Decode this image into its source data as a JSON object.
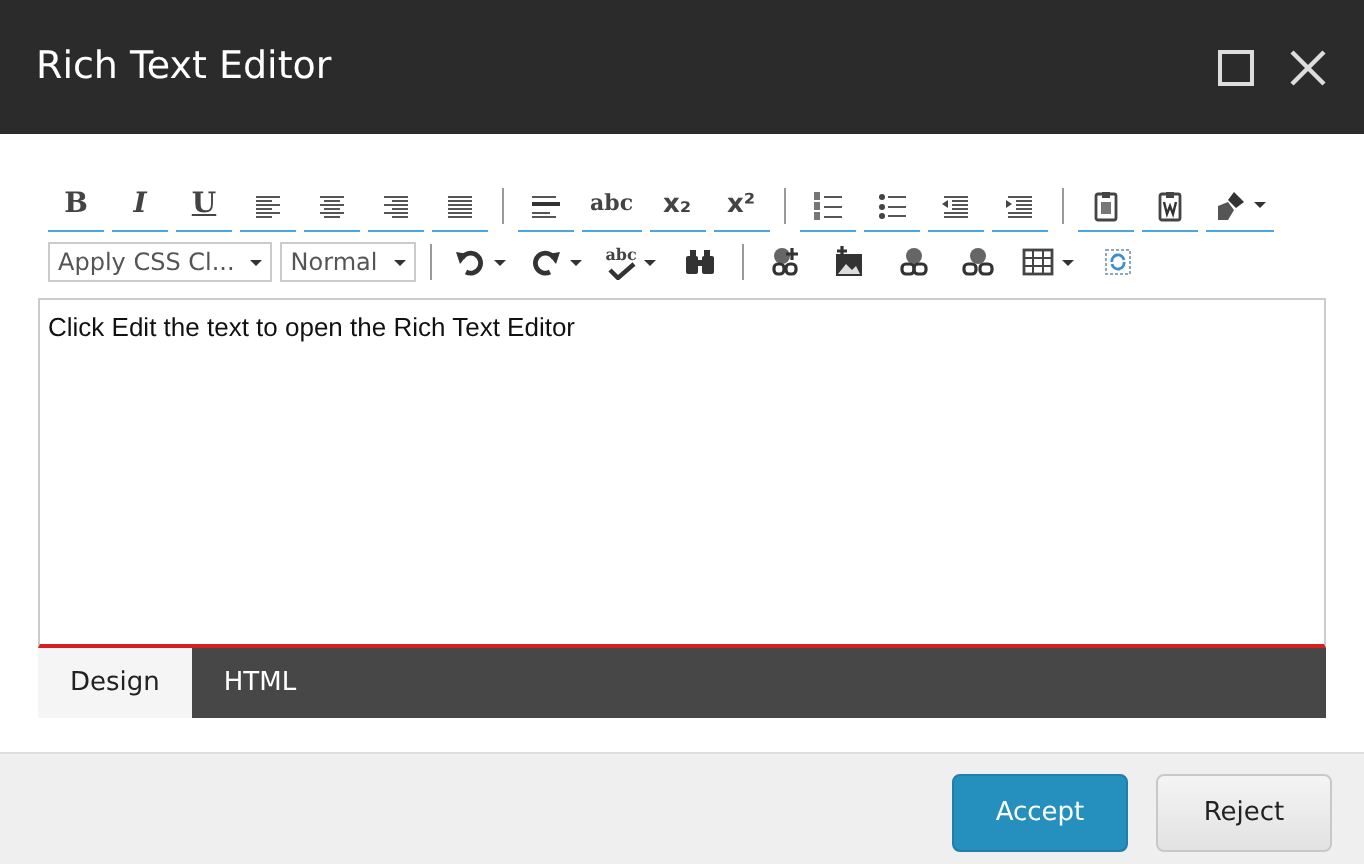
{
  "window": {
    "title": "Rich Text Editor"
  },
  "toolbar_row_1": [
    [
      {
        "kind": "bold",
        "label": "B"
      },
      {
        "kind": "italic",
        "label": "I"
      },
      {
        "kind": "underline",
        "label": "U"
      },
      {
        "kind": "alignleft"
      },
      {
        "kind": "aligncenter"
      },
      {
        "kind": "alignright"
      },
      {
        "kind": "justify"
      }
    ],
    [
      {
        "kind": "rule"
      },
      {
        "kind": "strike",
        "label": "abc"
      },
      {
        "kind": "subscript",
        "label": "x₂"
      },
      {
        "kind": "superscript",
        "label": "x²"
      }
    ],
    [
      {
        "kind": "orderedlist"
      },
      {
        "kind": "bulletlist"
      },
      {
        "kind": "outdent"
      },
      {
        "kind": "indent"
      }
    ],
    [
      {
        "kind": "paste"
      },
      {
        "kind": "pasteword"
      },
      {
        "kind": "brush",
        "has_menu": true
      }
    ]
  ],
  "toolbar_row_2": [
    [
      {
        "kind": "dropdown",
        "value": "Apply CSS Cl..."
      },
      {
        "kind": "dropdown",
        "value": "Normal"
      }
    ],
    [
      {
        "kind": "undo",
        "has_menu": true
      },
      {
        "kind": "redo",
        "has_menu": true
      },
      {
        "kind": "spellcheck",
        "label": "abc",
        "has_menu": true
      },
      {
        "kind": "binoculars"
      }
    ],
    [
      {
        "kind": "linkplus"
      },
      {
        "kind": "image"
      },
      {
        "kind": "link"
      },
      {
        "kind": "unlink"
      },
      {
        "kind": "table",
        "has_menu": true
      },
      {
        "kind": "selectall"
      }
    ]
  ],
  "editor": {
    "content": "Click Edit the text to open the Rich Text Editor"
  },
  "mode_tabs": [
    {
      "label": "Design",
      "selected": true
    },
    {
      "label": "HTML",
      "selected": false
    }
  ],
  "buttons": [
    {
      "label": "Accept",
      "kind": "primary"
    },
    {
      "label": "Reject",
      "kind": "secondary"
    }
  ]
}
